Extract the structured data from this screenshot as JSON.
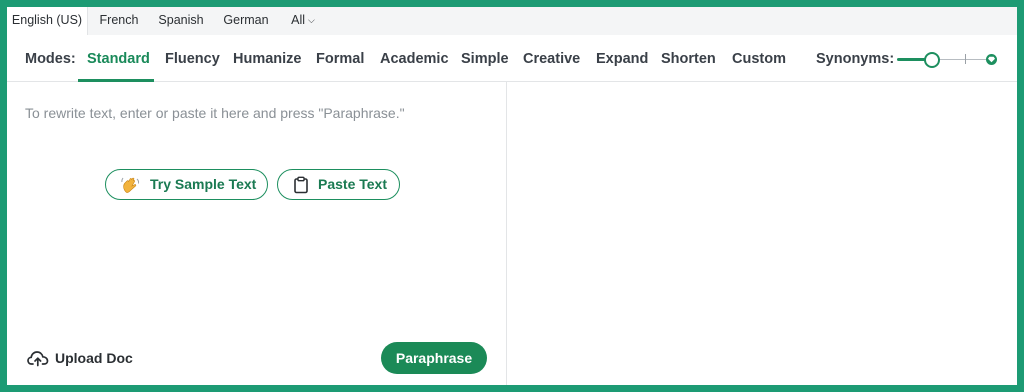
{
  "languages": {
    "tabs": [
      "English (US)",
      "French",
      "Spanish",
      "German",
      "All"
    ],
    "active": "English (US)"
  },
  "modes": {
    "label": "Modes:",
    "items": [
      "Standard",
      "Fluency",
      "Humanize",
      "Formal",
      "Academic",
      "Simple",
      "Creative",
      "Expand",
      "Shorten",
      "Custom"
    ],
    "active": "Standard"
  },
  "synonyms": {
    "label": "Synonyms:",
    "level": 0.35
  },
  "editor": {
    "placeholder": "To rewrite text, enter or paste it here and press \"Paraphrase.\"",
    "sample_button": "Try Sample Text",
    "paste_button": "Paste Text",
    "upload_label": "Upload Doc",
    "paraphrase_button": "Paraphrase"
  },
  "colors": {
    "accent": "#1d9b74",
    "primary_button": "#1b8a57",
    "active_text": "#1a8a5a"
  },
  "icons": {
    "sample": "waving-hand-icon",
    "paste": "clipboard-icon",
    "upload": "cloud-upload-icon",
    "premium": "diamond-icon"
  }
}
